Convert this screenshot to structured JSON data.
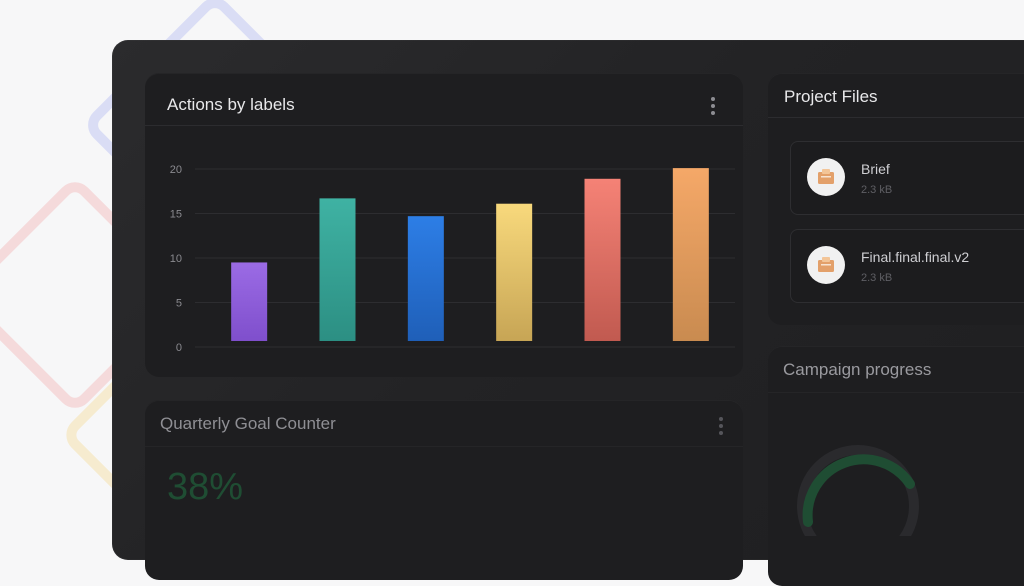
{
  "actions_card": {
    "title": "Actions by labels"
  },
  "chart_data": {
    "type": "bar",
    "categories": [
      "",
      "",
      "",
      "",
      "",
      ""
    ],
    "values": [
      9.5,
      16.7,
      14.7,
      16.1,
      18.9,
      20.1
    ],
    "colors": [
      [
        "#9b6be5",
        "#7f4fcc"
      ],
      [
        "#3fb2a3",
        "#2c8f83"
      ],
      [
        "#2d7ee6",
        "#1f5fb8"
      ],
      [
        "#f8d97c",
        "#c7a555"
      ],
      [
        "#f58276",
        "#c15a50"
      ],
      [
        "#f5a868",
        "#c98b50"
      ]
    ],
    "ylim": [
      0,
      20
    ],
    "yticks": [
      "0",
      "5",
      "10",
      "15",
      "20"
    ],
    "grid": true,
    "title": "",
    "xlabel": "",
    "ylabel": ""
  },
  "files_card": {
    "title": "Project Files",
    "files": [
      {
        "name": "Brief",
        "size": "2.3 kB"
      },
      {
        "name": "Final.final.final.v2",
        "size": "2.3 kB"
      }
    ]
  },
  "goal_card": {
    "title": "Quarterly Goal Counter",
    "percent": "38%"
  },
  "campaign_card": {
    "title": "Campaign progress"
  },
  "theme": {
    "background": "#f7f7f8",
    "card": "#1e1e20",
    "progress_green": "#1f4d33"
  }
}
